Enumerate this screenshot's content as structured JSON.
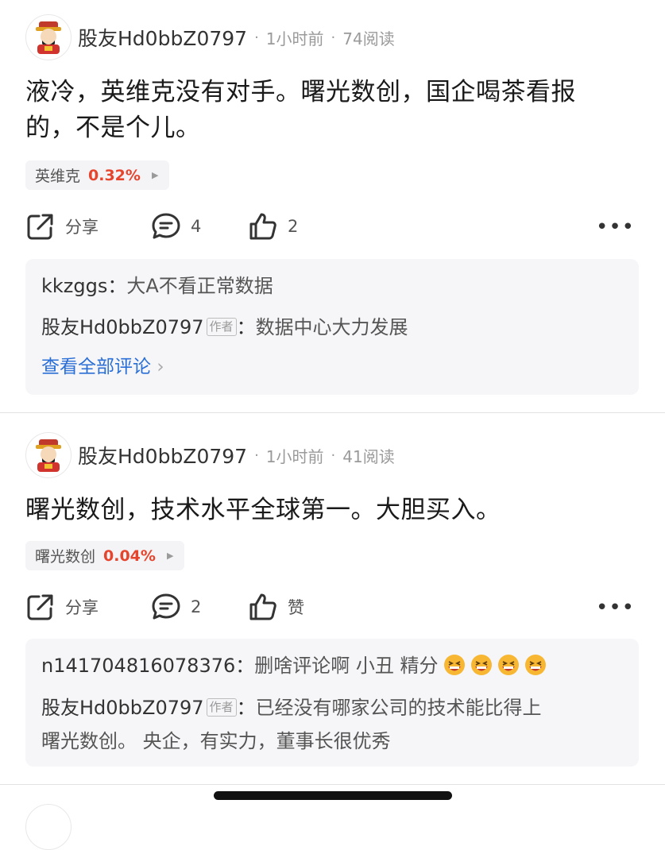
{
  "posts": [
    {
      "username": "股友Hd0bbZ0797",
      "time": "1小时前",
      "reads": "74阅读",
      "content_line1": "液冷，英维克没有对手。曙光数创，国企喝茶看报",
      "content_line2": "的，不是个儿。",
      "stock": {
        "name": "英维克",
        "change": "0.32%"
      },
      "actions": {
        "share": "分享",
        "comments": "4",
        "likes": "2"
      },
      "comments": [
        {
          "user": "kkzggs",
          "text": "大A不看正常数据"
        },
        {
          "user": "股友Hd0bbZ0797",
          "author_tag": "作者",
          "text": "数据中心大力发展"
        }
      ],
      "view_all": "查看全部评论"
    },
    {
      "username": "股友Hd0bbZ0797",
      "time": "1小时前",
      "reads": "41阅读",
      "content_line1": "曙光数创，技术水平全球第一。大胆买入。",
      "stock": {
        "name": "曙光数创",
        "change": "0.04%"
      },
      "actions": {
        "share": "分享",
        "comments": "2",
        "likes": "赞"
      },
      "comments": [
        {
          "user": "n141704816078376",
          "text": "删啥评论啊 小丑 精分"
        },
        {
          "user": "股友Hd0bbZ0797",
          "author_tag": "作者",
          "text_line1": "已经没有哪家公司的技术能比得上",
          "text_line2": "曙光数创。 央企，有实力，董事长很优秀"
        }
      ]
    }
  ],
  "colors": {
    "accent_red": "#e6452d",
    "link_blue": "#2a6fd6"
  },
  "icons": [
    "share-icon",
    "comment-icon",
    "like-icon",
    "more-icon",
    "laughing-emoji-icon"
  ]
}
